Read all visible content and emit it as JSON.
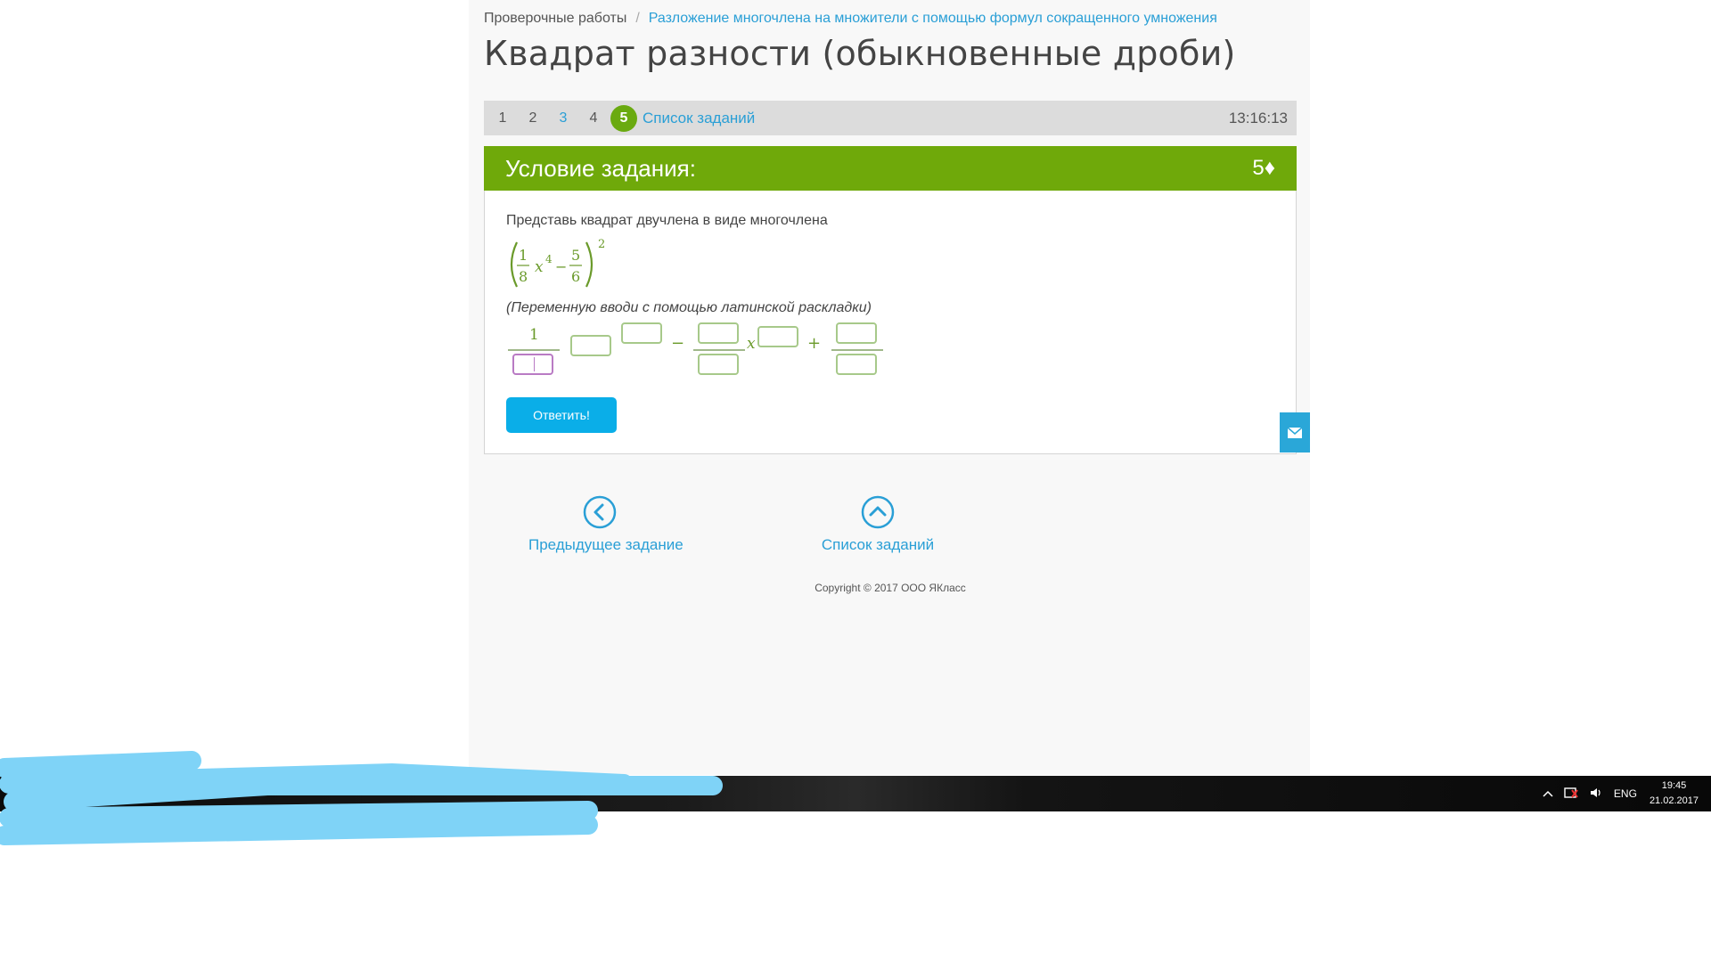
{
  "breadcrumb": {
    "parent": "Проверочные работы",
    "separator": "/",
    "current": "Разложение многочлена на множители с помощью формул сокращенного умножения"
  },
  "page_title": "Квадрат разности (обыкновенные дроби)",
  "task_nav": {
    "tasks": [
      {
        "label": "1",
        "state": "default"
      },
      {
        "label": "2",
        "state": "default"
      },
      {
        "label": "3",
        "state": "link"
      },
      {
        "label": "4",
        "state": "default"
      },
      {
        "label": "5",
        "state": "current"
      }
    ],
    "list_link": "Список заданий",
    "timer": "13:16:13"
  },
  "task": {
    "header": "Условие задания:",
    "points": "5♦",
    "prompt": "Представь квадрат двучлена в виде многочлена",
    "formula": {
      "frac1_num": "1",
      "frac1_den": "8",
      "var": "x",
      "exp": "4",
      "minus": "−",
      "frac2_num": "5",
      "frac2_den": "6",
      "outer_exp": "2"
    },
    "hint": "(Переменную вводи с помощью латинской раскладки)",
    "answer": {
      "term1_num": "1",
      "minus": "−",
      "var": "x",
      "plus": "+"
    },
    "submit_label": "Ответить!"
  },
  "bottom_nav": {
    "prev_label": "Предыдущее задание",
    "list_label": "Список заданий"
  },
  "copyright": "Copyright © 2017 ООО ЯКласс",
  "taskbar": {
    "lang": "ENG",
    "time": "19:45",
    "date": "21.02.2017"
  },
  "colors": {
    "accent_green": "#6fa90a",
    "link_blue": "#2a9fd6",
    "button_blue": "#0aaee8",
    "current_task": "#6aaa10"
  },
  "icons": [
    "chevron-left-icon",
    "chevron-up-icon",
    "mail-icon",
    "tray-up-icon",
    "network-icon",
    "volume-icon"
  ]
}
